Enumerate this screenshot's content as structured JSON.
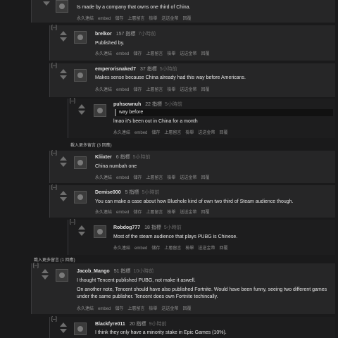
{
  "actions": {
    "permalink": "永久連結",
    "embed": "embed",
    "save": "儲存",
    "parent": "上層留言",
    "report": "檢舉",
    "gild": "送送金幣",
    "reply": "回覆"
  },
  "toggle": "[–]",
  "comments": [
    {
      "text": "Is made by a company that owns one third of China."
    },
    {
      "author": "brelkor",
      "points": "157 指標",
      "time": "7小時前",
      "text": "Published by."
    },
    {
      "author": "emperorisnaked7",
      "points": "37 指標",
      "time": "5小時前",
      "text": "Makes sense because China already had this way before Americans."
    },
    {
      "author": "puhsownuh",
      "points": "22 指標",
      "time": "5小時前",
      "quote": "way before",
      "text": "lmao it's been out in China for a month"
    },
    {
      "author": "Kliixter",
      "points": "6 指標",
      "time": "5小時前",
      "text": "China numbah one"
    },
    {
      "author": "Demise000",
      "points": "5 指標",
      "time": "5小時前",
      "text": "You can make a case about how Bluehole kind of own two third of Steam audience though."
    },
    {
      "author": "Robdog777",
      "points": "18 指標",
      "time": "5小時前",
      "text": "Most of the steam audience that plays PUBG is Chinese."
    },
    {
      "author": "Jacob_Mango",
      "points": "51 指標",
      "time": "10小時前",
      "text": "I thought Tencent published PUBG, not make it aswell.",
      "text2": "On another note, Tencent should have also published Fortnite. Would have been funny, seeing two different games under the same publisher. Tencent does own Fortnite techincally."
    },
    {
      "author": "Blackfyre011",
      "points": "20 指標",
      "time": "9小時前",
      "text": "I think they only have a minority stake in Epic Games (10%)."
    }
  ],
  "more1": "載入更多留言 (3 回應)",
  "more2": "載入更多留言 (1 回應)"
}
